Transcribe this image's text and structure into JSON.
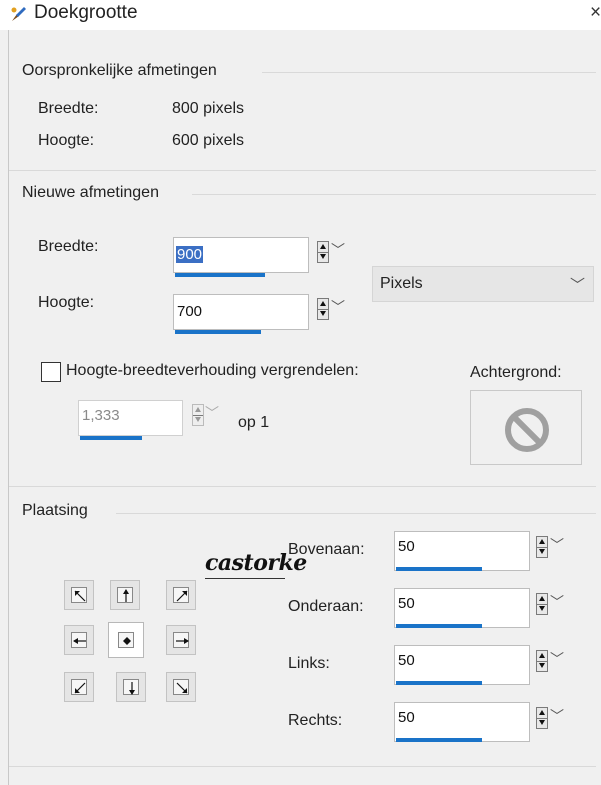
{
  "window": {
    "title": "Doekgrootte",
    "close_label": "×"
  },
  "original": {
    "group_title": "Oorspronkelijke afmetingen",
    "width_label": "Breedte:",
    "width_value": "800 pixels",
    "height_label": "Hoogte:",
    "height_value": "600 pixels"
  },
  "new_size": {
    "group_title": "Nieuwe afmetingen",
    "width_label": "Breedte:",
    "width_value": "900",
    "height_label": "Hoogte:",
    "height_value": "700",
    "unit_selected": "Pixels",
    "lock_ratio_label": "Hoogte-breedteverhouding vergrendelen:",
    "lock_ratio_checked": false,
    "ratio_value": "1,333",
    "ratio_suffix": "op 1",
    "background_label": "Achtergrond:",
    "background_icon": "no-symbol-icon"
  },
  "placement": {
    "group_title": "Plaatsing",
    "anchor_selected": "center",
    "top_label": "Bovenaan:",
    "top_value": "50",
    "bottom_label": "Onderaan:",
    "bottom_value": "50",
    "left_label": "Links:",
    "left_value": "50",
    "right_label": "Rechts:",
    "right_value": "50"
  },
  "watermark": {
    "text": "castorke"
  },
  "colors": {
    "accent_bar": "#1a73c8",
    "selection": "#3b6fc4",
    "dialog_bg": "#f0f0f0"
  }
}
